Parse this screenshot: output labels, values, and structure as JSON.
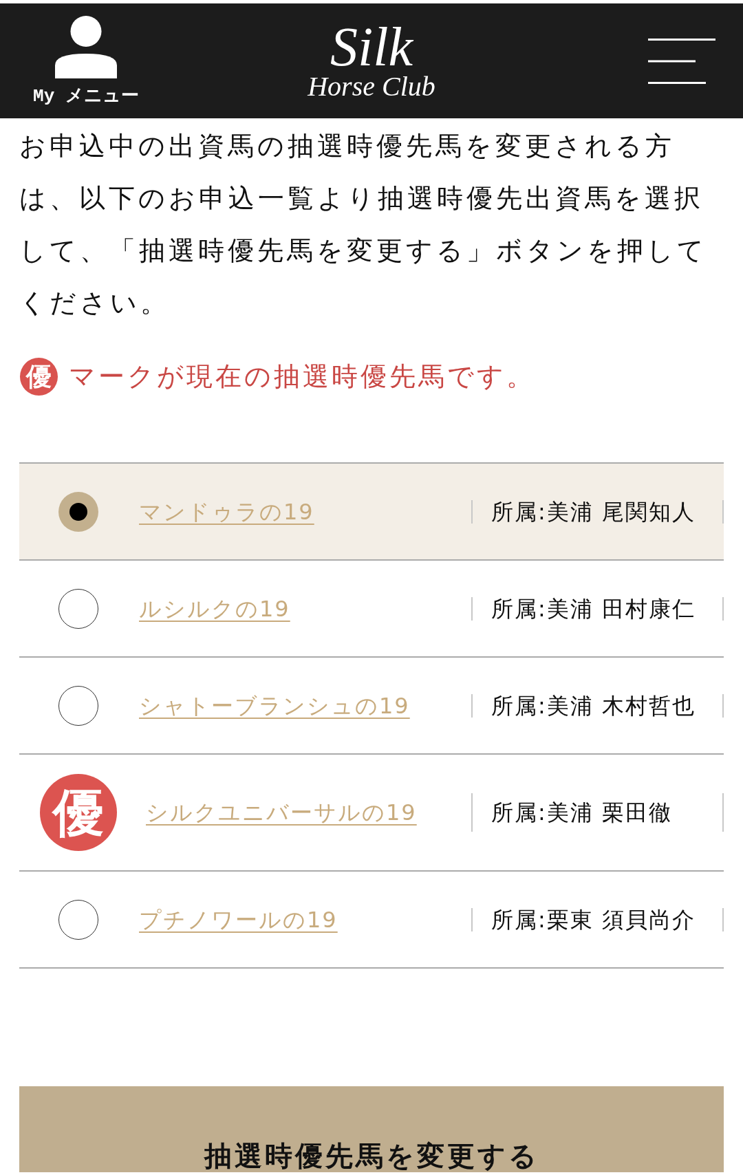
{
  "header": {
    "menu_label": "My メニュー",
    "logo": {
      "line_1": "Silk",
      "line_2": "Horse Club"
    }
  },
  "instructions": "お申込中の出資馬の抽選時優先馬を変更される方は、以下のお申込一覧より抽選時優先出資馬を選択して、「抽選時優先馬を変更する」ボタンを押してください。",
  "legend": {
    "mark": "優",
    "text": "マークが現在の抽選時優先馬です。"
  },
  "applications": [
    {
      "kind": "radio",
      "selected": true,
      "horse": "マンドゥラの19",
      "affiliation": "所属:美浦 尾関知人"
    },
    {
      "kind": "radio",
      "selected": false,
      "horse": "ルシルクの19",
      "affiliation": "所属:美浦 田村康仁"
    },
    {
      "kind": "radio",
      "selected": false,
      "horse": "シャトーブランシュの19",
      "affiliation": "所属:美浦 木村哲也"
    },
    {
      "kind": "priority",
      "selected": false,
      "mark": "優",
      "horse": "シルクユニバーサルの19",
      "affiliation": "所属:美浦 栗田徹"
    },
    {
      "kind": "radio",
      "selected": false,
      "horse": "プチノワールの19",
      "affiliation": "所属:栗東 須貝尚介"
    }
  ],
  "submit_button": "抽選時優先馬を変更する"
}
